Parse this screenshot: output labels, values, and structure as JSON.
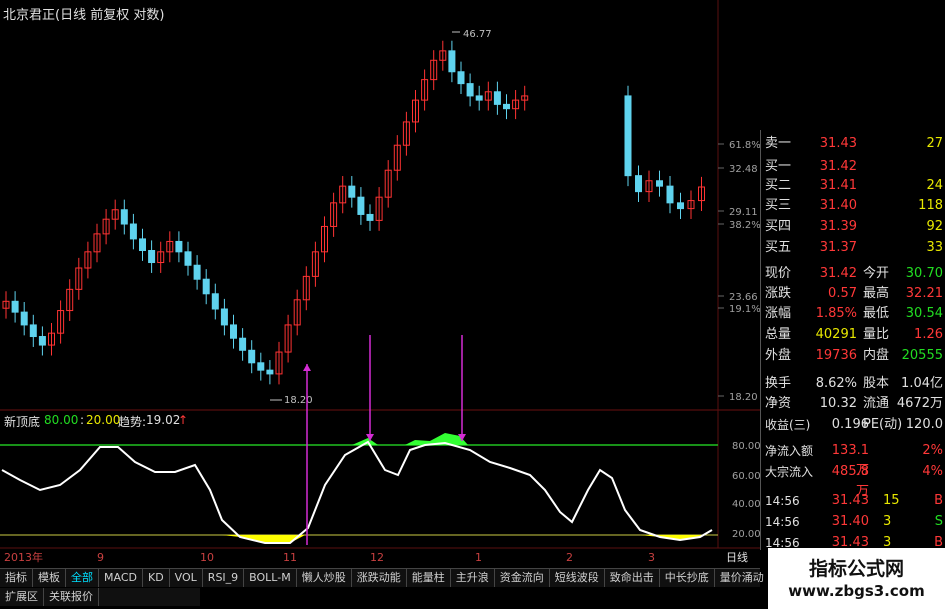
{
  "title": "北京君正(日线 前复权 对数)",
  "colors": {
    "up": "#ff3333",
    "down": "#5fd3ee",
    "hline_top": "#21c321",
    "hline_bottom": "#cccc44",
    "fill_top": "#33ff33",
    "fill_bottom": "#ffff00",
    "curve": "#ffffff",
    "arrow": "#d42cd4"
  },
  "price_axis": {
    "labels": [
      "61.8%",
      "32.48",
      "29.11",
      "38.2%",
      "23.66",
      "19.1%",
      "18.20"
    ]
  },
  "annotations": {
    "high": "46.77",
    "low": "18.20"
  },
  "indicator": {
    "name": "新顶底",
    "p1": "80.00",
    "p2": "20.00",
    "trend_label": "趋势:",
    "trend_value": "19.02",
    "trend_arrow": "↑",
    "axis": [
      "80.00",
      "60.00",
      "40.00",
      "20.00"
    ]
  },
  "x_axis": [
    "2013年",
    "9",
    "10",
    "11",
    "12",
    "1",
    "2",
    "3",
    "日线"
  ],
  "chart_data": {
    "type": "candlestick",
    "title": "北京君正(日线 前复权 对数)",
    "ohlc_close_estimates": [
      22.5,
      21.8,
      21.0,
      20.3,
      19.8,
      20.5,
      21.9,
      23.3,
      24.8,
      26.0,
      27.4,
      28.6,
      29.4,
      28.2,
      27.0,
      26.1,
      25.2,
      26.0,
      26.8,
      26.0,
      25.0,
      24.0,
      23.0,
      22.0,
      21.0,
      20.2,
      19.5,
      18.8,
      18.4,
      18.2,
      19.4,
      21.0,
      22.6,
      24.2,
      26.0,
      28.0,
      30.0,
      31.5,
      30.5,
      29.0,
      28.5,
      30.5,
      33.0,
      35.5,
      38.0,
      40.5,
      43.0,
      45.5,
      46.77,
      44.0,
      42.5,
      41.0,
      40.5,
      41.5,
      40.0,
      39.5,
      40.5,
      41.0,
      32.48,
      31.0,
      32.0,
      31.5,
      30.0,
      29.5,
      30.2,
      31.42
    ],
    "ylim": [
      18.2,
      46.77
    ],
    "indicator": {
      "name": "新顶底",
      "upper": 80,
      "lower": 20,
      "current": 19.02
    }
  },
  "panel": {
    "rows": [
      {
        "k": "卖一",
        "v": "31.43",
        "v2": "27",
        "vc": "#ff3838",
        "v2c": "#e8e800"
      },
      {
        "k": "买一",
        "v": "31.42",
        "v2": "",
        "vc": "#ff3838",
        "v2c": "#e8e800"
      },
      {
        "k": "买二",
        "v": "31.41",
        "v2": "24",
        "vc": "#ff3838",
        "v2c": "#e8e800"
      },
      {
        "k": "买三",
        "v": "31.40",
        "v2": "118",
        "vc": "#ff3838",
        "v2c": "#e8e800"
      },
      {
        "k": "买四",
        "v": "31.39",
        "v2": "92",
        "vc": "#ff3838",
        "v2c": "#e8e800"
      },
      {
        "k": "买五",
        "v": "31.37",
        "v2": "33",
        "vc": "#ff3838",
        "v2c": "#e8e800"
      },
      {
        "k": "现价",
        "v": "31.42",
        "k2": "今开",
        "v2": "30.70",
        "vc": "#ff3838",
        "v2c": "#22dd22"
      },
      {
        "k": "涨跌",
        "v": "0.57",
        "k2": "最高",
        "v2": "32.21",
        "vc": "#ff3838",
        "v2c": "#ff3838"
      },
      {
        "k": "涨幅",
        "v": "1.85%",
        "k2": "最低",
        "v2": "30.54",
        "vc": "#ff3838",
        "v2c": "#22dd22"
      },
      {
        "k": "总量",
        "v": "40291",
        "k2": "量比",
        "v2": "1.26",
        "vc": "#e8e800",
        "v2c": "#ff3838"
      },
      {
        "k": "外盘",
        "v": "19736",
        "k2": "内盘",
        "v2": "20555",
        "vc": "#ff3838",
        "v2c": "#22dd22"
      },
      {
        "k": "换手",
        "v": "8.62%",
        "k2": "股本",
        "v2": "1.04亿",
        "vc": "#e0e0e0",
        "v2c": "#e0e0e0"
      },
      {
        "k": "净资",
        "v": "10.32",
        "k2": "流通",
        "v2": "4672万",
        "vc": "#e0e0e0",
        "v2c": "#e0e0e0"
      },
      {
        "k": "收益(三)",
        "v": "0.196",
        "k2": "PE(动)",
        "v2": "120.0",
        "vc": "#e0e0e0",
        "v2c": "#e0e0e0"
      },
      {
        "k": "净流入额",
        "v": "133.1万",
        "v2": "2%",
        "vc": "#ff3838",
        "v2c": "#ff3838"
      },
      {
        "k": "大宗流入",
        "v": "485.8万",
        "v2": "4%",
        "vc": "#ff3838",
        "v2c": "#ff3838"
      },
      {
        "k": "14:56",
        "v": "31.43",
        "k2": "15",
        "v2": "B",
        "vc": "#ff3838",
        "v2c": "#ff3838"
      },
      {
        "k": "14:56",
        "v": "31.40",
        "k2": "3",
        "v2": "S",
        "vc": "#ff3838",
        "v2c": "#22dd22"
      },
      {
        "k": "14:56",
        "v": "31.43",
        "k2": "3",
        "v2": "B",
        "vc": "#ff3838",
        "v2c": "#ff3838"
      }
    ]
  },
  "tabs": [
    "指标",
    "模板",
    "全部",
    "MACD",
    "KD",
    "VOL",
    "RSI_9",
    "BOLL-M",
    "懒人炒股",
    "涨跌动能",
    "能量柱",
    "主升浪",
    "资金流向",
    "短线波段",
    "致命出击",
    "中长抄底",
    "量价涌动"
  ],
  "tabs2": [
    "扩展区",
    "关联报价"
  ],
  "watermark": {
    "line1": "指标公式网",
    "line2": "www.zbgs3.com"
  }
}
